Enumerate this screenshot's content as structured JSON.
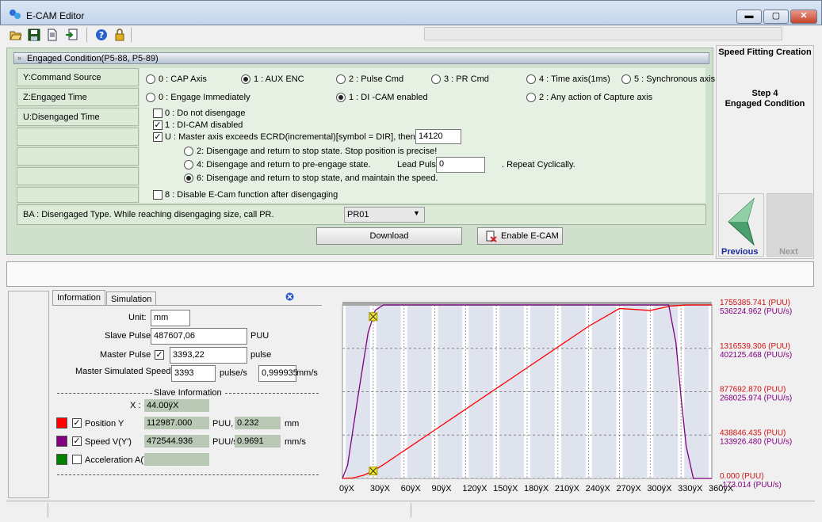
{
  "window": {
    "title": "E-CAM Editor",
    "min_label": "▬",
    "max_label": "▢",
    "close_label": "✕"
  },
  "toolbar": {
    "icons": [
      "open-icon",
      "save-icon",
      "document-icon",
      "export-icon",
      "help-icon",
      "lock-icon"
    ]
  },
  "engaged": {
    "header": "Engaged Condition(P5-88, P5-89)",
    "rows": [
      {
        "label": "Y:Command Source"
      },
      {
        "label": "Z:Engaged Time"
      },
      {
        "label": "U:Disengaged Time"
      }
    ],
    "command_source": [
      {
        "label": "0 : CAP Axis",
        "checked": false
      },
      {
        "label": "1 : AUX  ENC",
        "checked": true
      },
      {
        "label": "2 : Pulse Cmd",
        "checked": false
      },
      {
        "label": "3 : PR Cmd",
        "checked": false
      },
      {
        "label": "4 : Time axis(1ms)",
        "checked": false
      },
      {
        "label": "5 : Synchronous axis",
        "checked": false
      }
    ],
    "engaged_time": [
      {
        "label": "0 : Engage Immediately",
        "checked": false
      },
      {
        "label": "1 : DI -CAM enabled",
        "checked": true
      },
      {
        "label": "2 : Any action of Capture axis",
        "checked": false
      }
    ],
    "disengaged": {
      "opt0": {
        "label": "0 : Do not disengage",
        "checked": false
      },
      "opt1": {
        "label": "1 : DI-CAM disabled",
        "checked": true
      },
      "optU": {
        "label": "U : Master axis exceeds ECRD(incremental)[symbol = DIR], then",
        "checked": true
      },
      "ecrd_value": "14120",
      "sub2": {
        "label": "2: Disengage and return to stop state. Stop position is precise!",
        "checked": false
      },
      "sub4": {
        "label": "4: Disengage and return to pre-engage state.",
        "checked": false
      },
      "lead_pulse_label": "Lead Pulse",
      "lead_pulse_value": "0",
      "repeat_label": ". Repeat Cyclically.",
      "sub6": {
        "label": "6: Disengage and return to stop state, and maintain the speed.",
        "checked": true
      },
      "opt8": {
        "label": "8 : Disable E-Cam function after disengaging",
        "checked": false
      }
    },
    "ba_label": "BA : Disengaged Type. While reaching disengaging size, call PR.",
    "ba_select": "PR01",
    "download_label": "Download",
    "enable_label": "Enable E-CAM"
  },
  "wizard": {
    "title": "Speed Fitting Creation",
    "step": "Step 4",
    "step_name": "Engaged Condition",
    "previous_label": "Previous",
    "next_label": "Next"
  },
  "info": {
    "tabs": [
      "Information",
      "Simulation"
    ],
    "unit_label": "Unit:",
    "unit_value": "mm",
    "slave_pulse_label": "Slave Pulse",
    "slave_pulse_value": "487607,06",
    "slave_pulse_unit": "PUU",
    "master_pulse_label": "Master Pulse",
    "master_pulse_value": "3393,22",
    "master_pulse_unit": "pulse",
    "master_pulse_checked": true,
    "master_speed_label": "Master Simulated Speed",
    "master_speed_value": "3393",
    "master_speed_unit": "pulse/s",
    "master_speed_mm": "0,999935",
    "master_speed_mm_unit": "mm/s",
    "slave_info_label": "Slave Information",
    "x_label": "X :",
    "x_value": "44.00ÿX",
    "position_label": "Position Y",
    "position_value": "112987.000",
    "position_unit": "PUU,",
    "position_mm": "0.232",
    "position_mm_unit": "mm",
    "speed_label": "Speed V(Y')",
    "speed_value": "472544.936",
    "speed_unit": "PUU/s,",
    "speed_mm": "0.9691",
    "speed_mm_unit": "mm/s",
    "accel_label": "Acceleration A(Y",
    "colors": {
      "position": "#ff0000",
      "speed": "#800080",
      "accel": "#008000"
    }
  },
  "chart_data": {
    "type": "line",
    "x_ticks": [
      "0ÿX",
      "30ÿX",
      "60ÿX",
      "90ÿX",
      "120ÿX",
      "150ÿX",
      "180ÿX",
      "210ÿX",
      "240ÿX",
      "270ÿX",
      "300ÿX",
      "330ÿX",
      "360ÿX"
    ],
    "xlim": [
      0,
      360
    ],
    "right_labels": [
      {
        "puu": "1755385.741  (PUU)",
        "puus": "536224.962  (PUU/s)"
      },
      {
        "puu": "1316539.306  (PUU)",
        "puus": "402125.468  (PUU/s)"
      },
      {
        "puu": "877692.870  (PUU)",
        "puus": "268025.974  (PUU/s)"
      },
      {
        "puu": "438846.435  (PUU)",
        "puus": "133926.480  (PUU/s)"
      },
      {
        "puu": "0.000  (PUU)",
        "puus": "-173.014  (PUU/s)"
      }
    ],
    "series": [
      {
        "color": "#ff0000",
        "x": [
          0,
          10,
          20,
          30,
          40,
          60,
          90,
          120,
          150,
          180,
          210,
          240,
          270,
          300,
          320,
          335,
          345,
          360
        ],
        "y": [
          0,
          5000,
          30000,
          75000,
          140000,
          280000,
          490000,
          700000,
          910000,
          1120000,
          1330000,
          1540000,
          1720000,
          1700000,
          1745000,
          1755000,
          1755385,
          1755385
        ]
      },
      {
        "color": "#800080",
        "x": [
          0,
          5,
          15,
          25,
          32,
          40,
          300,
          318,
          325,
          330,
          335,
          342,
          360
        ],
        "y": [
          -173,
          40000,
          250000,
          450000,
          520000,
          536224,
          536224,
          536224,
          420000,
          250000,
          100000,
          0,
          -173
        ]
      }
    ],
    "ylim_pos": [
      0,
      1755385.741
    ],
    "ylim_speed": [
      -173.014,
      536224.962
    ],
    "markers": [
      {
        "x": 30,
        "series": 0
      },
      {
        "x": 30,
        "series": 1
      }
    ]
  }
}
